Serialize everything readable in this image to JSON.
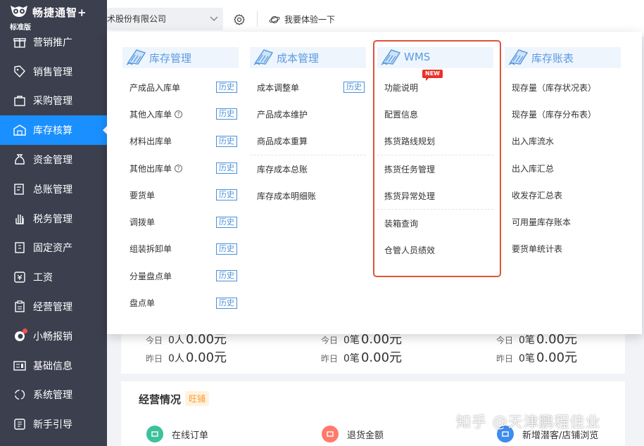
{
  "app": {
    "name": "畅捷通智+",
    "edition": "标准版"
  },
  "sidebar": {
    "items": [
      {
        "label": "营销推广",
        "icon": "gift-icon"
      },
      {
        "label": "销售管理",
        "icon": "tag-icon"
      },
      {
        "label": "采购管理",
        "icon": "bag-icon"
      },
      {
        "label": "库存核算",
        "icon": "warehouse-icon",
        "active": true
      },
      {
        "label": "资金管理",
        "icon": "money-bag-icon"
      },
      {
        "label": "总账管理",
        "icon": "ledger-icon"
      },
      {
        "label": "税务管理",
        "icon": "hand-icon"
      },
      {
        "label": "固定资产",
        "icon": "building-icon"
      },
      {
        "label": "工资",
        "icon": "payroll-icon"
      },
      {
        "label": "经营管理",
        "icon": "clipboard-icon"
      },
      {
        "label": "小畅报销",
        "icon": "reimburse-icon",
        "dot": true
      },
      {
        "label": "基础信息",
        "icon": "info-card-icon"
      },
      {
        "label": "系统管理",
        "icon": "system-icon"
      },
      {
        "label": "新手引导",
        "icon": "guide-icon"
      }
    ]
  },
  "topbar": {
    "company": "术股份有限公司",
    "try_label": "我要体验一下"
  },
  "menu": {
    "columns": [
      {
        "title": "库存管理",
        "groups": [
          [
            {
              "label": "产成品入库单",
              "history": "历史"
            },
            {
              "label": "其他入库单",
              "help": "?",
              "history": "历史"
            },
            {
              "label": "材料出库单",
              "history": "历史"
            },
            {
              "label": "其他出库单",
              "help": "?",
              "history": "历史"
            },
            {
              "label": "要货单",
              "history": "历史"
            },
            {
              "label": "调拨单",
              "history": "历史"
            },
            {
              "label": "组装拆卸单",
              "history": "历史"
            },
            {
              "label": "分量盘点单",
              "history": "历史"
            },
            {
              "label": "盘点单",
              "history": "历史"
            }
          ]
        ]
      },
      {
        "title": "成本管理",
        "groups": [
          [
            {
              "label": "成本调整单",
              "history": "历史"
            },
            {
              "label": "产品成本维护"
            },
            {
              "label": "商品成本重算"
            }
          ],
          [
            {
              "label": "库存成本总账"
            },
            {
              "label": "库存成本明细账"
            }
          ]
        ]
      },
      {
        "title": "WMS",
        "groups": [
          [
            {
              "label": "功能说明",
              "badge": "NEW"
            },
            {
              "label": "配置信息"
            },
            {
              "label": "拣货路线规划"
            }
          ],
          [
            {
              "label": "拣货任务管理"
            },
            {
              "label": "拣货异常处理"
            }
          ],
          [
            {
              "label": "装箱查询"
            },
            {
              "label": "仓管人员绩效"
            }
          ]
        ]
      },
      {
        "title": "库存账表",
        "groups": [
          [
            {
              "label": "现存量（库存状况表）"
            },
            {
              "label": "现存量（库存分布表）"
            },
            {
              "label": "出入库流水"
            },
            {
              "label": "出入库汇总"
            },
            {
              "label": "收发存汇总表"
            },
            {
              "label": "可用量库存账本"
            },
            {
              "label": "要货单统计表"
            }
          ]
        ]
      }
    ]
  },
  "stats": [
    {
      "today": "今日",
      "today_count": "0人",
      "today_amount": "0.00元",
      "yday": "昨日",
      "yday_count": "0人",
      "yday_amount": "0.00元"
    },
    {
      "today": "今日",
      "today_count": "0笔",
      "today_amount": "0.00元",
      "yday": "昨日",
      "yday_count": "0笔",
      "yday_amount": "0.00元"
    },
    {
      "today": "今日",
      "today_count": "0笔",
      "today_amount": "0.00元",
      "yday": "昨日",
      "yday_count": "0笔",
      "yday_amount": "0.00元"
    }
  ],
  "business": {
    "title": "经营情况",
    "tag": "旺铺",
    "items": [
      {
        "label": "在线订单",
        "color": "#3cc29a"
      },
      {
        "label": "退货金额",
        "color": "#ff7a6b"
      },
      {
        "label": "新增潜客/店铺浏览",
        "color": "#3d8cf0"
      }
    ]
  },
  "watermark": "知乎 @天津鹏程佳业",
  "colors": {
    "sidebar_bg": "#3b3f4e",
    "active": "#1a8fff",
    "accent": "#5a9be0",
    "highlight_box": "#e0533d"
  }
}
